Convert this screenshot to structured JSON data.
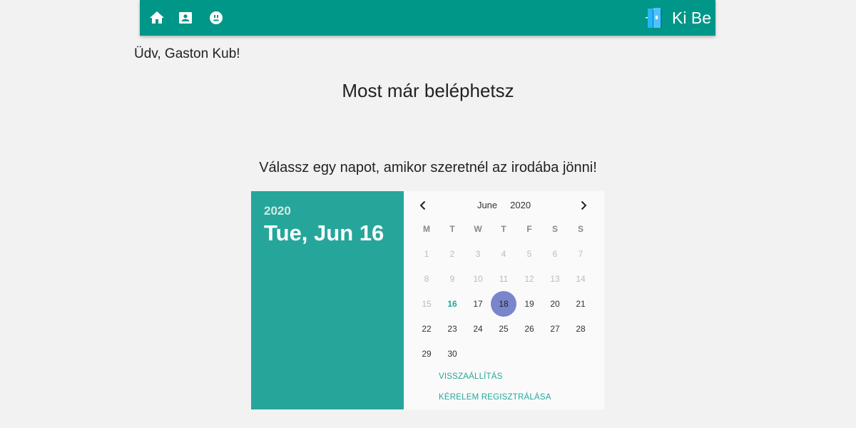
{
  "topbar": {
    "nav": [
      {
        "icon": "home-icon"
      },
      {
        "icon": "contact-card-icon"
      },
      {
        "icon": "mood-icon"
      }
    ],
    "brand_text": "Ki Be",
    "colors": {
      "bar": "#009688"
    }
  },
  "greeting": "Üdv, Gaston Kub!",
  "headline": "Most már beléphetsz",
  "instruction": "Válassz egy napot, amikor szeretnél az irodába jönni!",
  "datepicker": {
    "year": "2020",
    "selected_date_label": "Tue, Jun 16",
    "month": "June",
    "month_year": "2020",
    "weekdays": [
      "M",
      "T",
      "W",
      "T",
      "F",
      "S",
      "S"
    ],
    "weeks": [
      [
        {
          "d": "1",
          "s": "disabled"
        },
        {
          "d": "2",
          "s": "disabled"
        },
        {
          "d": "3",
          "s": "disabled"
        },
        {
          "d": "4",
          "s": "disabled"
        },
        {
          "d": "5",
          "s": "disabled"
        },
        {
          "d": "6",
          "s": "disabled"
        },
        {
          "d": "7",
          "s": "disabled"
        }
      ],
      [
        {
          "d": "8",
          "s": "disabled"
        },
        {
          "d": "9",
          "s": "disabled"
        },
        {
          "d": "10",
          "s": "disabled"
        },
        {
          "d": "11",
          "s": "disabled"
        },
        {
          "d": "12",
          "s": "disabled"
        },
        {
          "d": "13",
          "s": "disabled"
        },
        {
          "d": "14",
          "s": "disabled"
        }
      ],
      [
        {
          "d": "15",
          "s": "disabled"
        },
        {
          "d": "16",
          "s": "today"
        },
        {
          "d": "17",
          "s": ""
        },
        {
          "d": "18",
          "s": "selected"
        },
        {
          "d": "19",
          "s": ""
        },
        {
          "d": "20",
          "s": ""
        },
        {
          "d": "21",
          "s": ""
        }
      ],
      [
        {
          "d": "22",
          "s": ""
        },
        {
          "d": "23",
          "s": ""
        },
        {
          "d": "24",
          "s": ""
        },
        {
          "d": "25",
          "s": ""
        },
        {
          "d": "26",
          "s": ""
        },
        {
          "d": "27",
          "s": ""
        },
        {
          "d": "28",
          "s": ""
        }
      ],
      [
        {
          "d": "29",
          "s": ""
        },
        {
          "d": "30",
          "s": ""
        },
        {
          "d": "",
          "s": "empty"
        },
        {
          "d": "",
          "s": "empty"
        },
        {
          "d": "",
          "s": "empty"
        },
        {
          "d": "",
          "s": "empty"
        },
        {
          "d": "",
          "s": "empty"
        }
      ]
    ],
    "reset_label": "VISSZAÁLLÍTÁS",
    "register_label": "KÉRELEM REGISZTRÁLÁSA",
    "colors": {
      "side": "#26a69a",
      "selected": "#7986cb",
      "accent": "#26a69a"
    }
  }
}
